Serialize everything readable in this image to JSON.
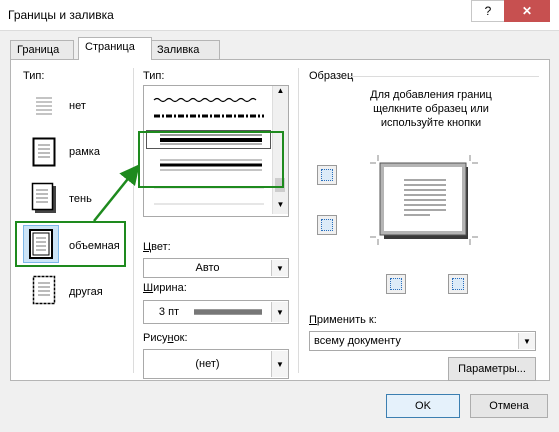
{
  "window": {
    "title": "Границы и заливка",
    "help_label": "?",
    "close_label": "✕"
  },
  "tabs": [
    {
      "label": "Граница",
      "active": false
    },
    {
      "label": "Страница",
      "active": true
    },
    {
      "label": "Заливка",
      "active": false
    }
  ],
  "settings": {
    "label": "Тип:",
    "items": [
      {
        "label": "нет",
        "icon": "none-page-icon",
        "selected": false
      },
      {
        "label": "рамка",
        "icon": "box-page-icon",
        "selected": false
      },
      {
        "label": "тень",
        "icon": "shadow-page-icon",
        "selected": false
      },
      {
        "label": "объемная",
        "icon": "3d-page-icon",
        "selected": true
      },
      {
        "label": "другая",
        "icon": "custom-page-icon",
        "selected": false
      }
    ]
  },
  "style": {
    "label": "Тип:"
  },
  "color": {
    "label": "Цвет:",
    "value": "Авто"
  },
  "width": {
    "label": "Ширина:",
    "value": "3 пт"
  },
  "art": {
    "label": "Рисунок:",
    "value": "(нет)"
  },
  "preview": {
    "label": "Образец",
    "instructions": [
      "Для добавления границ",
      "щелкните образец или",
      "используйте кнопки"
    ]
  },
  "apply_to": {
    "label": "Применить к:",
    "value": "всему документу"
  },
  "buttons": {
    "options": "Параметры...",
    "ok": "OK",
    "cancel": "Отмена"
  },
  "colors": {
    "highlight": "#1e8a1e",
    "close": "#c75050",
    "selection": "#cce4f7"
  }
}
